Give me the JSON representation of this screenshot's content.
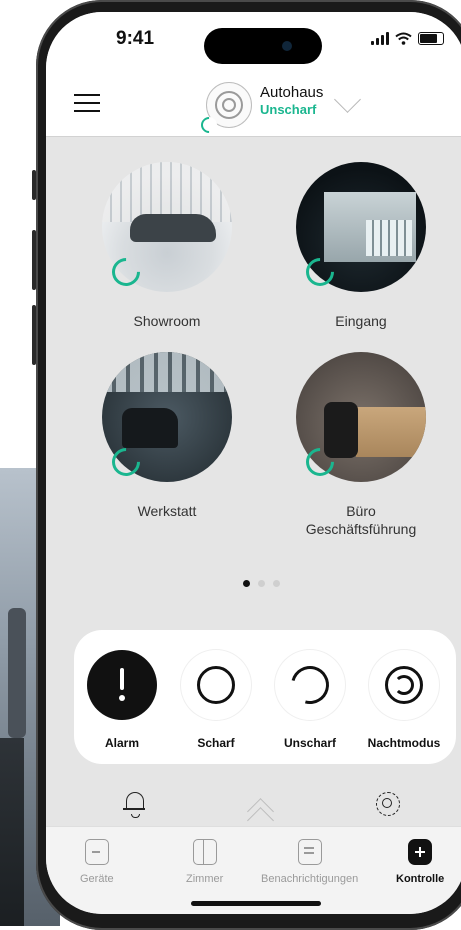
{
  "status_bar": {
    "time": "9:41"
  },
  "header": {
    "title": "Autohaus",
    "status": "Unscharf"
  },
  "rooms": [
    {
      "name": "Showroom"
    },
    {
      "name": "Eingang"
    },
    {
      "name": "Werkstatt"
    },
    {
      "name": "Büro Geschäftsführung",
      "line1": "Büro",
      "line2": "Geschäftsführung"
    }
  ],
  "pager": {
    "pages": 3,
    "active": 1
  },
  "modes": [
    {
      "label": "Alarm",
      "icon": "alarm-icon"
    },
    {
      "label": "Scharf",
      "icon": "armed-icon"
    },
    {
      "label": "Unscharf",
      "icon": "disarmed-icon"
    },
    {
      "label": "Nachtmodus",
      "icon": "night-mode-icon"
    }
  ],
  "tabs": [
    {
      "label": "Geräte",
      "icon": "devices-icon"
    },
    {
      "label": "Zimmer",
      "icon": "rooms-icon"
    },
    {
      "label": "Benachrichtigungen",
      "icon": "notifications-icon"
    },
    {
      "label": "Kontrolle",
      "icon": "control-icon",
      "active": true
    }
  ],
  "colors": {
    "accent": "#1ab68f",
    "screen_bg": "#e5e5e5",
    "dark": "#111111"
  }
}
